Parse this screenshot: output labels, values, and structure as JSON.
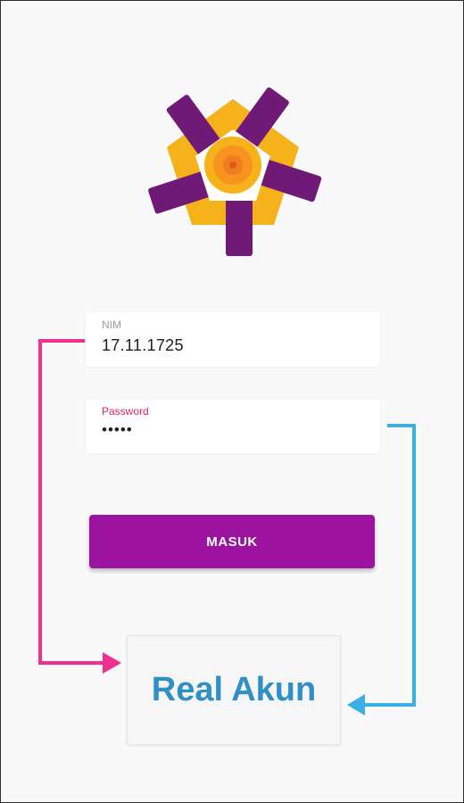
{
  "login": {
    "nim": {
      "label": "NIM",
      "value": "17.11.1725"
    },
    "password": {
      "label": "Password",
      "value": "•••••"
    },
    "submit_label": "MASUK"
  },
  "annotation": {
    "text": "Real Akun",
    "colors": {
      "left_arrow": "#f0308f",
      "right_arrow": "#3aaee6",
      "text": "#2f8fc7"
    }
  },
  "colors": {
    "accent": "#9c13a0",
    "logo_purple": "#6e1a76",
    "logo_gold": "#f6b21b",
    "logo_orange": "#ef7d1f"
  },
  "icons": {
    "logo": "pentagon-pinwheel-logo",
    "arrows": [
      "arrow-right",
      "arrow-left"
    ]
  }
}
